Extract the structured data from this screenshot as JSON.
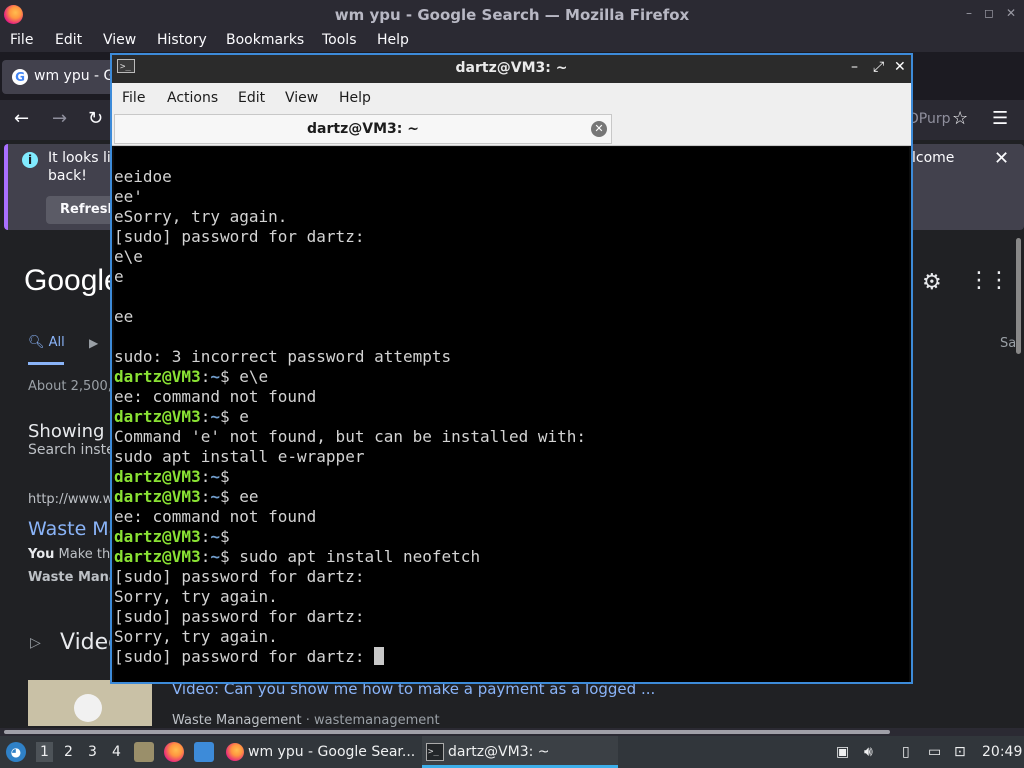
{
  "firefox": {
    "window_title": "wm ypu - Google Search — Mozilla Firefox",
    "window_buttons": [
      "–",
      "◻",
      "✕"
    ],
    "menu": [
      "File",
      "Edit",
      "View",
      "History",
      "Bookmarks",
      "Tools",
      "Help"
    ],
    "tab_label": "wm ypu - Go",
    "tab_favicon": "G",
    "nav": {
      "back": "←",
      "forward": "→",
      "reload": "↻",
      "url_fragment": "DPurp",
      "bookmark_star": "☆",
      "menu": "☰"
    },
    "notice": {
      "line1": "It looks lik",
      "line2": "back!",
      "refresh_label": "Refresh",
      "welcome_fragment": "lcome",
      "close": "✕",
      "info": "i"
    }
  },
  "google": {
    "logo": "Google",
    "gear": "⚙",
    "apps": "⋮⋮⋮",
    "tab_all": "All",
    "tab_right": "Sa",
    "about": "About 2,500,",
    "showing": "Showing re",
    "instead": "Search inste",
    "result_url": "http://www.wr",
    "result_title": "Waste Ma",
    "result_snip_bold": "You",
    "result_snip": " Make the",
    "result_snip2": "Waste Manag",
    "videos_heading": "Video",
    "video_title": "Video: Can you show me how to make a payment as a logged ...",
    "video_source_name": "Waste Management",
    "video_source_site": " · wastemanagement"
  },
  "terminal": {
    "window_title": "dartz@VM3: ~",
    "icon": ">_",
    "menu": [
      "File",
      "Actions",
      "Edit",
      "View",
      "Help"
    ],
    "tab_label": "dartz@VM3: ~",
    "tab_close": "✕",
    "user": "dartz@VM3",
    "path_sep": ":",
    "path": "~",
    "prompt_end": "$ ",
    "lines": [
      {
        "type": "out",
        "text": "eeidoe"
      },
      {
        "type": "out",
        "text": "ee'"
      },
      {
        "type": "out",
        "text": "eSorry, try again."
      },
      {
        "type": "out",
        "text": "[sudo] password for dartz:"
      },
      {
        "type": "out",
        "text": "e\\e"
      },
      {
        "type": "out",
        "text": "e"
      },
      {
        "type": "out",
        "text": ""
      },
      {
        "type": "out",
        "text": "ee"
      },
      {
        "type": "out",
        "text": ""
      },
      {
        "type": "out",
        "text": "sudo: 3 incorrect password attempts"
      },
      {
        "type": "prompt",
        "text": "e\\e"
      },
      {
        "type": "out",
        "text": "ee: command not found"
      },
      {
        "type": "prompt",
        "text": "e"
      },
      {
        "type": "out",
        "text": "Command 'e' not found, but can be installed with:"
      },
      {
        "type": "out",
        "text": "sudo apt install e-wrapper"
      },
      {
        "type": "prompt",
        "text": ""
      },
      {
        "type": "prompt",
        "text": "ee"
      },
      {
        "type": "out",
        "text": "ee: command not found"
      },
      {
        "type": "prompt",
        "text": ""
      },
      {
        "type": "prompt",
        "text": "sudo apt install neofetch"
      },
      {
        "type": "out",
        "text": "[sudo] password for dartz:"
      },
      {
        "type": "out",
        "text": "Sorry, try again."
      },
      {
        "type": "out",
        "text": "[sudo] password for dartz:"
      },
      {
        "type": "out",
        "text": "Sorry, try again."
      },
      {
        "type": "cursor",
        "text": "[sudo] password for dartz: "
      }
    ]
  },
  "taskbar": {
    "desktops": [
      "1",
      "2",
      "3",
      "4"
    ],
    "tasks": [
      {
        "label": "wm ypu - Google Sear...",
        "icon": "firefox-icon"
      },
      {
        "label": "dartz@VM3: ~",
        "icon": "terminal-icon"
      }
    ],
    "clock": "20:49"
  },
  "colors": {
    "accent": "#3d8bd9",
    "prompt_user": "#8ae234",
    "prompt_path": "#729fcf",
    "link": "#8ab4f8"
  }
}
